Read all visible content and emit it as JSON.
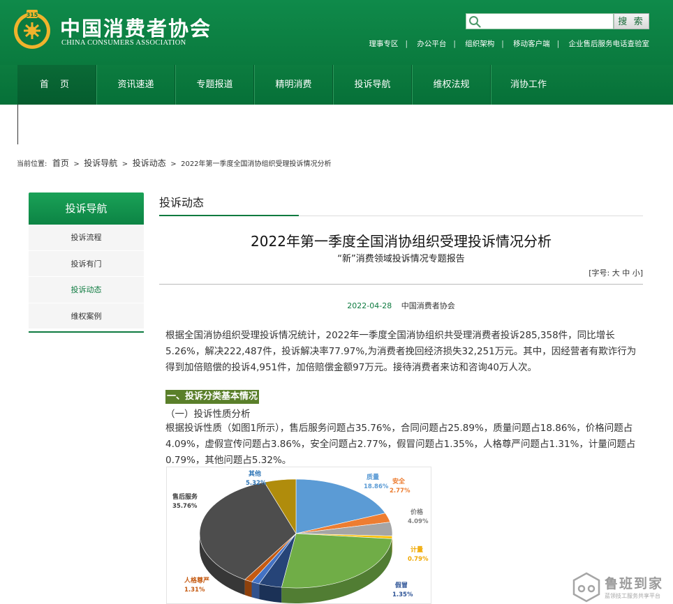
{
  "header": {
    "title": "中国消费者协会",
    "subtitle": "CHINA CONSUMERS ASSOCIATION",
    "search_placeholder": "",
    "search_button": "搜 索",
    "links": [
      "理事专区",
      "办公平台",
      "组织架构",
      "移动客户端",
      "企业售后服务电话查验室"
    ]
  },
  "nav": {
    "items": [
      "首 页",
      "资讯速递",
      "专题报道",
      "精明消费",
      "投诉导航",
      "维权法规",
      "消协工作"
    ]
  },
  "breadcrumb": {
    "label": "当前位置:",
    "crumbs": [
      "首页",
      "投诉导航",
      "投诉动态"
    ],
    "current": "2022年第一季度全国消协组织受理投诉情况分析"
  },
  "sidebar": {
    "title": "投诉导航",
    "items": [
      {
        "label": "投诉流程"
      },
      {
        "label": "投诉有门"
      },
      {
        "label": "投诉动态"
      },
      {
        "label": "维权案例"
      }
    ]
  },
  "section": {
    "title": "投诉动态"
  },
  "article": {
    "title": "2022年第一季度全国消协组织受理投诉情况分析",
    "subtitle": "“新”消费领域投诉情况专题报告",
    "font_size_label": "[字号:",
    "font_size_options": [
      "大",
      "中",
      "小"
    ],
    "font_size_close": "]",
    "date": "2022-04-28",
    "source": "中国消费者协会",
    "para1": "根据全国消协组织受理投诉情况统计，2022年一季度全国消协组织共受理消费者投诉285,358件，同比增长5.26%，解决222,487件，投诉解决率77.97%,为消费者挽回经济损失32,251万元。其中，因经营者有欺诈行为得到加倍赔偿的投诉4,951件，加倍赔偿金额97万元。接待消费者来访和咨询40万人次。",
    "section_heading": "一、投诉分类基本情况",
    "sub_heading": "（一）投诉性质分析",
    "para2": "根据投诉性质（如图1所示），售后服务问题占35.76%，合同问题占25.89%，质量问题占18.86%，价格问题占4.09%，虚假宣传问题占3.86%，安全问题占2.77%，假冒问题占1.35%，人格尊严问题占1.31%，计量问题占0.79%，其他问题占5.32%。"
  },
  "chart_data": {
    "type": "pie",
    "title": "",
    "slices": [
      {
        "label": "质量",
        "value": 18.86,
        "color": "#5b9bd5"
      },
      {
        "label": "安全",
        "value": 2.77,
        "color": "#ed7d31"
      },
      {
        "label": "价格",
        "value": 4.09,
        "color": "#a5a5a5"
      },
      {
        "label": "计量",
        "value": 0.79,
        "color": "#ffc000"
      },
      {
        "label": "合同",
        "value": 25.89,
        "color": "#70ad47"
      },
      {
        "label": "虚假宣传",
        "value": 3.86,
        "color": "#264478"
      },
      {
        "label": "假冒",
        "value": 1.35,
        "color": "#4472c4"
      },
      {
        "label": "人格尊严",
        "value": 1.31,
        "color": "#c55a11"
      },
      {
        "label": "售后服务",
        "value": 35.76,
        "color": "#4d4d4d"
      },
      {
        "label": "其他",
        "value": 5.32,
        "color": "#b08c0c"
      }
    ],
    "visible_labels": [
      {
        "name": "质量",
        "pct": "18.86%"
      },
      {
        "name": "安全",
        "pct": "2.77%"
      },
      {
        "name": "价格",
        "pct": "4.09%"
      },
      {
        "name": "计量",
        "pct": "0.79%"
      },
      {
        "name": "假冒",
        "pct": "1.35%"
      },
      {
        "name": "人格尊严",
        "pct": "1.31%"
      },
      {
        "name": "售后服务",
        "pct": "35.76%"
      },
      {
        "name": "其他",
        "pct": "5.32%"
      }
    ]
  },
  "watermark": {
    "title": "鲁班到家",
    "subtitle": "蓝领技工服务共享平台"
  },
  "colors": {
    "brand_green": "#0d7a3f",
    "nav_green": "#067038",
    "section_bg": "#5a7f2a"
  },
  "icons": {
    "logo": "cca-logo-icon",
    "search": "search-icon",
    "watermark": "luban-logo-icon"
  }
}
